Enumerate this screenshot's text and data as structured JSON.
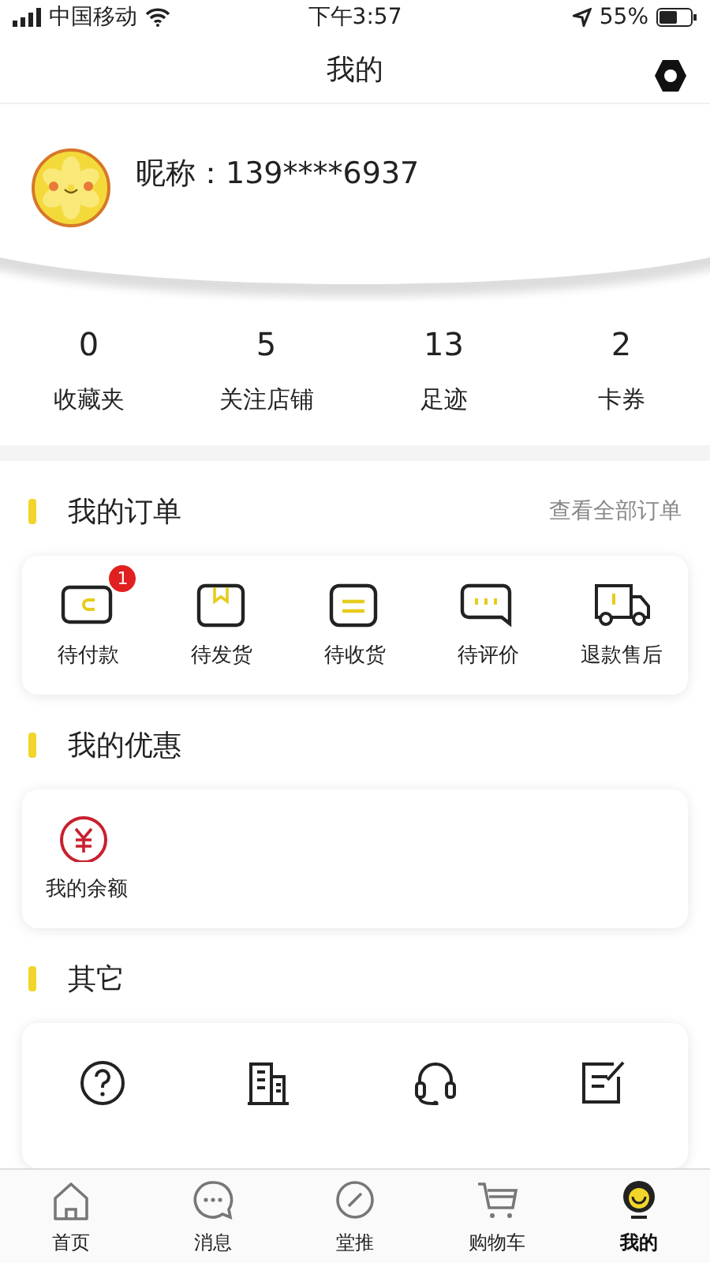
{
  "status_bar": {
    "carrier": "中国移动",
    "time": "下午3:57",
    "battery": "55%"
  },
  "nav": {
    "title": "我的"
  },
  "profile": {
    "nickname": "昵称：139****6937"
  },
  "stats": [
    {
      "value": "0",
      "label": "收藏夹"
    },
    {
      "value": "5",
      "label": "关注店铺"
    },
    {
      "value": "13",
      "label": "足迹"
    },
    {
      "value": "2",
      "label": "卡券"
    }
  ],
  "orders": {
    "title": "我的订单",
    "link": "查看全部订单",
    "items": [
      {
        "kind": "wallet",
        "label": "待付款",
        "badge": "1"
      },
      {
        "kind": "box",
        "label": "待发货"
      },
      {
        "kind": "receive",
        "label": "待收货"
      },
      {
        "kind": "comment",
        "label": "待评价"
      },
      {
        "kind": "truck",
        "label": "退款售后"
      }
    ]
  },
  "benefits": {
    "title": "我的优惠",
    "items": [
      {
        "kind": "yuan",
        "label": "我的余额"
      }
    ]
  },
  "other": {
    "title": "其它",
    "items": [
      {
        "kind": "question"
      },
      {
        "kind": "building"
      },
      {
        "kind": "headset"
      },
      {
        "kind": "note"
      }
    ]
  },
  "tabs": [
    {
      "kind": "home",
      "label": "首页",
      "selected": false
    },
    {
      "kind": "chat",
      "label": "消息",
      "selected": false
    },
    {
      "kind": "compass",
      "label": "堂推",
      "selected": false
    },
    {
      "kind": "cart",
      "label": "购物车",
      "selected": false
    },
    {
      "kind": "me",
      "label": "我的",
      "selected": true
    }
  ]
}
